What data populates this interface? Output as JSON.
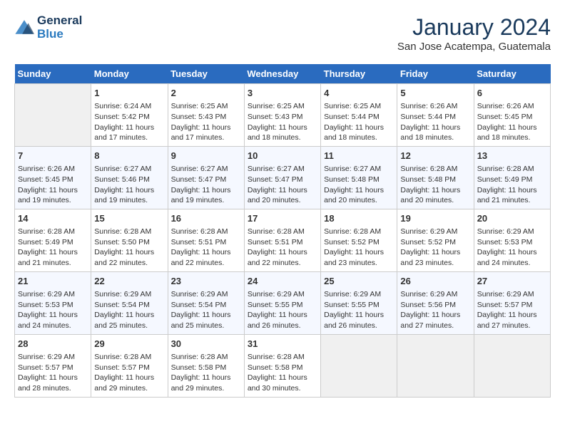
{
  "header": {
    "logo_line1": "General",
    "logo_line2": "Blue",
    "month_title": "January 2024",
    "subtitle": "San Jose Acatempa, Guatemala"
  },
  "days_of_week": [
    "Sunday",
    "Monday",
    "Tuesday",
    "Wednesday",
    "Thursday",
    "Friday",
    "Saturday"
  ],
  "weeks": [
    [
      {
        "day": "",
        "empty": true
      },
      {
        "day": "1",
        "sunrise": "6:24 AM",
        "sunset": "5:42 PM",
        "daylight": "11 hours and 17 minutes."
      },
      {
        "day": "2",
        "sunrise": "6:25 AM",
        "sunset": "5:43 PM",
        "daylight": "11 hours and 17 minutes."
      },
      {
        "day": "3",
        "sunrise": "6:25 AM",
        "sunset": "5:43 PM",
        "daylight": "11 hours and 18 minutes."
      },
      {
        "day": "4",
        "sunrise": "6:25 AM",
        "sunset": "5:44 PM",
        "daylight": "11 hours and 18 minutes."
      },
      {
        "day": "5",
        "sunrise": "6:26 AM",
        "sunset": "5:44 PM",
        "daylight": "11 hours and 18 minutes."
      },
      {
        "day": "6",
        "sunrise": "6:26 AM",
        "sunset": "5:45 PM",
        "daylight": "11 hours and 18 minutes."
      }
    ],
    [
      {
        "day": "7",
        "sunrise": "6:26 AM",
        "sunset": "5:45 PM",
        "daylight": "11 hours and 19 minutes."
      },
      {
        "day": "8",
        "sunrise": "6:27 AM",
        "sunset": "5:46 PM",
        "daylight": "11 hours and 19 minutes."
      },
      {
        "day": "9",
        "sunrise": "6:27 AM",
        "sunset": "5:47 PM",
        "daylight": "11 hours and 19 minutes."
      },
      {
        "day": "10",
        "sunrise": "6:27 AM",
        "sunset": "5:47 PM",
        "daylight": "11 hours and 20 minutes."
      },
      {
        "day": "11",
        "sunrise": "6:27 AM",
        "sunset": "5:48 PM",
        "daylight": "11 hours and 20 minutes."
      },
      {
        "day": "12",
        "sunrise": "6:28 AM",
        "sunset": "5:48 PM",
        "daylight": "11 hours and 20 minutes."
      },
      {
        "day": "13",
        "sunrise": "6:28 AM",
        "sunset": "5:49 PM",
        "daylight": "11 hours and 21 minutes."
      }
    ],
    [
      {
        "day": "14",
        "sunrise": "6:28 AM",
        "sunset": "5:49 PM",
        "daylight": "11 hours and 21 minutes."
      },
      {
        "day": "15",
        "sunrise": "6:28 AM",
        "sunset": "5:50 PM",
        "daylight": "11 hours and 22 minutes."
      },
      {
        "day": "16",
        "sunrise": "6:28 AM",
        "sunset": "5:51 PM",
        "daylight": "11 hours and 22 minutes."
      },
      {
        "day": "17",
        "sunrise": "6:28 AM",
        "sunset": "5:51 PM",
        "daylight": "11 hours and 22 minutes."
      },
      {
        "day": "18",
        "sunrise": "6:28 AM",
        "sunset": "5:52 PM",
        "daylight": "11 hours and 23 minutes."
      },
      {
        "day": "19",
        "sunrise": "6:29 AM",
        "sunset": "5:52 PM",
        "daylight": "11 hours and 23 minutes."
      },
      {
        "day": "20",
        "sunrise": "6:29 AM",
        "sunset": "5:53 PM",
        "daylight": "11 hours and 24 minutes."
      }
    ],
    [
      {
        "day": "21",
        "sunrise": "6:29 AM",
        "sunset": "5:53 PM",
        "daylight": "11 hours and 24 minutes."
      },
      {
        "day": "22",
        "sunrise": "6:29 AM",
        "sunset": "5:54 PM",
        "daylight": "11 hours and 25 minutes."
      },
      {
        "day": "23",
        "sunrise": "6:29 AM",
        "sunset": "5:54 PM",
        "daylight": "11 hours and 25 minutes."
      },
      {
        "day": "24",
        "sunrise": "6:29 AM",
        "sunset": "5:55 PM",
        "daylight": "11 hours and 26 minutes."
      },
      {
        "day": "25",
        "sunrise": "6:29 AM",
        "sunset": "5:55 PM",
        "daylight": "11 hours and 26 minutes."
      },
      {
        "day": "26",
        "sunrise": "6:29 AM",
        "sunset": "5:56 PM",
        "daylight": "11 hours and 27 minutes."
      },
      {
        "day": "27",
        "sunrise": "6:29 AM",
        "sunset": "5:57 PM",
        "daylight": "11 hours and 27 minutes."
      }
    ],
    [
      {
        "day": "28",
        "sunrise": "6:29 AM",
        "sunset": "5:57 PM",
        "daylight": "11 hours and 28 minutes."
      },
      {
        "day": "29",
        "sunrise": "6:28 AM",
        "sunset": "5:57 PM",
        "daylight": "11 hours and 29 minutes."
      },
      {
        "day": "30",
        "sunrise": "6:28 AM",
        "sunset": "5:58 PM",
        "daylight": "11 hours and 29 minutes."
      },
      {
        "day": "31",
        "sunrise": "6:28 AM",
        "sunset": "5:58 PM",
        "daylight": "11 hours and 30 minutes."
      },
      {
        "day": "",
        "empty": true
      },
      {
        "day": "",
        "empty": true
      },
      {
        "day": "",
        "empty": true
      }
    ]
  ],
  "labels": {
    "sunrise": "Sunrise:",
    "sunset": "Sunset:",
    "daylight": "Daylight:"
  }
}
